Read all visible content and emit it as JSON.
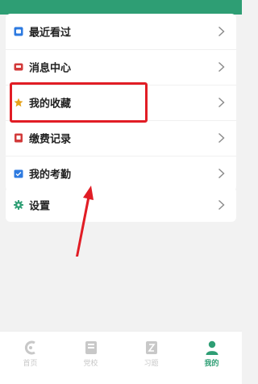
{
  "menu": {
    "items": [
      {
        "label": "最近看过",
        "icon": "recent-icon",
        "color": "#2d7ae0"
      },
      {
        "label": "消息中心",
        "icon": "message-icon",
        "color": "#d23a3a"
      },
      {
        "label": "我的收藏",
        "icon": "star-icon",
        "color": "#e6a21a"
      },
      {
        "label": "缴费记录",
        "icon": "receipt-icon",
        "color": "#d23a3a"
      },
      {
        "label": "我的考勤",
        "icon": "attendance-icon",
        "color": "#2d7ae0"
      }
    ],
    "settings": {
      "label": "设置",
      "icon": "gear-icon",
      "color": "#2e9e74"
    }
  },
  "annotation": {
    "highlighted": "我的收藏",
    "color": "#e11d25"
  },
  "bottom_nav": {
    "tabs": [
      {
        "label": "首页",
        "icon": "home-icon",
        "active": false
      },
      {
        "label": "党校",
        "icon": "school-icon",
        "active": false
      },
      {
        "label": "习题",
        "icon": "exercise-icon",
        "active": false
      },
      {
        "label": "我的",
        "icon": "user-icon",
        "active": true
      }
    ]
  },
  "colors": {
    "brand": "#2e9e74",
    "background": "#f2f2f2"
  }
}
